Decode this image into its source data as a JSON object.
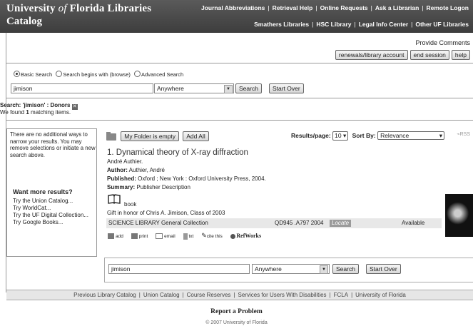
{
  "header": {
    "brand_pre": "University",
    "brand_of": "of",
    "brand_post": "Florida Libraries",
    "brand_sub": "Catalog",
    "nav1": [
      "Journal Abbreviations",
      "Retrieval Help",
      "Online Requests",
      "Ask a Librarian",
      "Remote Logon"
    ],
    "nav2": [
      "Smathers Libraries",
      "HSC Library",
      "Legal Info Center",
      "Other UF Libraries"
    ]
  },
  "account": {
    "provide": "Provide Comments",
    "renewals": "renewals/library account",
    "end_session": "end session",
    "help": "help"
  },
  "search": {
    "radio_basic": "Basic Search",
    "radio_browse": "Search begins with (browse)",
    "radio_advanced": "Advanced Search",
    "query": "jimison",
    "scope": "Anywhere",
    "search_button": "Search",
    "startover_button": "Start Over"
  },
  "results_summary": {
    "search_label": "Search: 'jimison' : Donors",
    "found_pre": "We found",
    "found_count": "1",
    "found_post": "matching items."
  },
  "sidebar": {
    "message": "There are no additional ways to narrow your results. You may remove selections or initiate a new search above.",
    "more_title": "Want more results?",
    "links": [
      "Try the Union Catalog...",
      "Try WorldCat...",
      "Try the UF Digital Collection...",
      "Try Google Books..."
    ]
  },
  "toolbar": {
    "folder": "My Folder is empty",
    "add_all": "Add All",
    "rpp_label": "Results/page:",
    "rpp_value": "10",
    "sort_label": "Sort By:",
    "sort_value": "Relevance",
    "rss": "RSS"
  },
  "record": {
    "title": "1. Dynamical theory of X-ray diffraction",
    "author_line": "André Authier.",
    "author_label": "Author:",
    "author_value": "Authier, André",
    "published_label": "Published:",
    "published_value": "Oxford ; New York : Oxford University Press, 2004.",
    "summary_label": "Summary:",
    "summary_value": "Publisher Description",
    "format": "book",
    "gift": "Gift in honor of Chris A. Jimison, Class of 2003",
    "holding": {
      "location": "SCIENCE LIBRARY General Collection",
      "callnum": "QD945 .A797 2004",
      "locate": "Locate",
      "status": "Available"
    },
    "tools": [
      "add",
      "print",
      "email",
      "txt",
      "cite this",
      "RefWorks"
    ]
  },
  "footer": {
    "links": [
      "Previous Library Catalog",
      "Union Catalog",
      "Course Reserves",
      "Services for Users With Disabilities",
      "FCLA",
      "University of Florida"
    ],
    "report": "Report a Problem",
    "copyright": "© 2007 University of Florida"
  }
}
